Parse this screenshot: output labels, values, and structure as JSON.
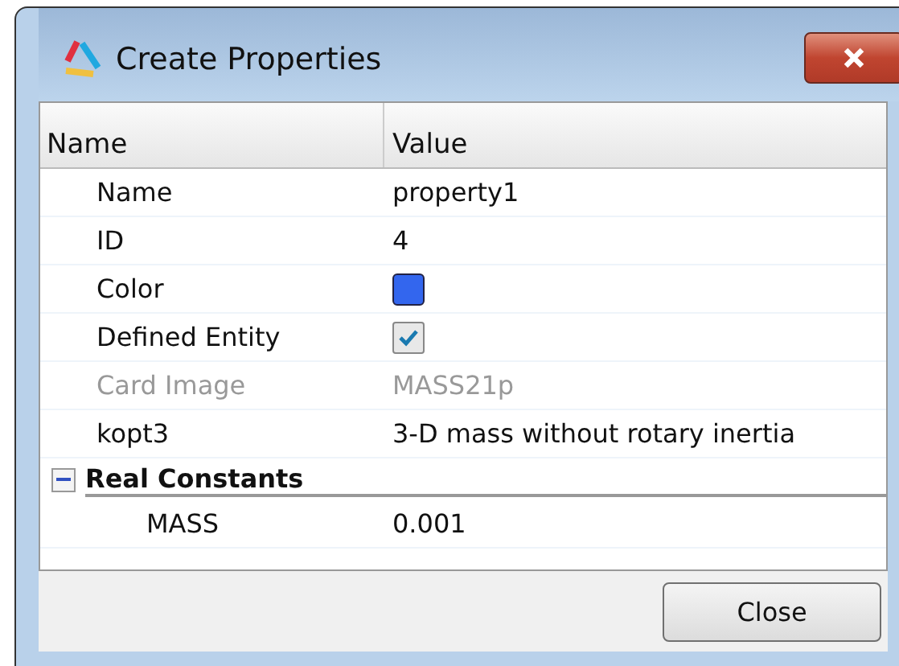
{
  "window": {
    "title": "Create Properties"
  },
  "table": {
    "columns": [
      "Name",
      "Value"
    ],
    "rows": [
      {
        "kind": "text",
        "name": "Name",
        "value": "property1",
        "disabled": false
      },
      {
        "kind": "text",
        "name": "ID",
        "value": "4",
        "disabled": false
      },
      {
        "kind": "color",
        "name": "Color",
        "color": "#3366ee",
        "disabled": false
      },
      {
        "kind": "checkbox",
        "name": "Defined Entity",
        "checked": true,
        "disabled": false
      },
      {
        "kind": "text",
        "name": "Card Image",
        "value": "MASS21p",
        "disabled": true
      },
      {
        "kind": "text",
        "name": "kopt3",
        "value": "3-D mass without rotary inertia",
        "disabled": false
      }
    ],
    "groups": [
      {
        "label": "Real Constants",
        "expanded": true,
        "rows": [
          {
            "name": "MASS",
            "value": "0.001"
          }
        ]
      }
    ]
  },
  "buttons": [
    "Close"
  ]
}
